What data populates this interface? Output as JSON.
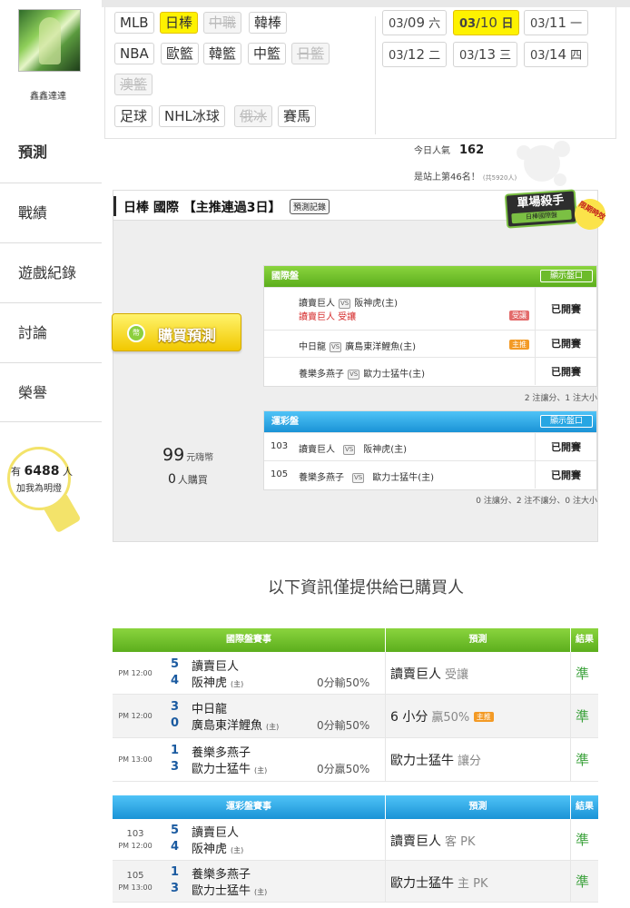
{
  "profile": {
    "username": "鑫鑫達達"
  },
  "nav": [
    {
      "label": "預測"
    },
    {
      "label": "戰績"
    },
    {
      "label": "遊戲紀錄"
    },
    {
      "label": "討論"
    },
    {
      "label": "榮譽"
    }
  ],
  "fans": {
    "prefix": "有",
    "count": "6488",
    "suffix": "人",
    "cta": "加我為明燈"
  },
  "leagues": {
    "row1": [
      "MLB",
      "日棒",
      "中職",
      "韓棒"
    ],
    "row2": [
      "NBA",
      "歐籃",
      "韓籃",
      "中籃",
      "日籃"
    ],
    "row3": [
      "澳籃"
    ],
    "row4": [
      "足球",
      "NHL冰球",
      "俄冰",
      "賽馬"
    ]
  },
  "dates": [
    {
      "md": "03/",
      "d": "09",
      "w": "六"
    },
    {
      "md": "03/",
      "d": "10",
      "w": "日"
    },
    {
      "md": "03/",
      "d": "11",
      "w": "一"
    },
    {
      "md": "03/",
      "d": "12",
      "w": "二"
    },
    {
      "md": "03/",
      "d": "13",
      "w": "三"
    },
    {
      "md": "03/",
      "d": "14",
      "w": "四"
    }
  ],
  "stats": {
    "pop_label": "今日人氣",
    "pop_value": "162",
    "rank_text": "是站上第46名！",
    "rank_note": "(共5920人)"
  },
  "header": {
    "title": "日棒 國際 【主推連過3日】",
    "record_btn": "預測記錄"
  },
  "badges": {
    "killer": "單場殺手",
    "killer_sub": "日棒國際盤",
    "limited": "限期時效"
  },
  "pricing": {
    "price": "99",
    "unit": "元嗨幣",
    "buyers": "0",
    "buyers_label": "人購買",
    "buy_label": "購買預測",
    "buy_icon": "coin-icon"
  },
  "intl": {
    "title": "國際盤",
    "show_btn": "顯示盤口",
    "rows": [
      {
        "away": "讀賣巨人",
        "home": "阪神虎(主)",
        "pick": "讀賣巨人 受讓",
        "tag": "受讓",
        "result": "已開賽"
      },
      {
        "away": "中日龍",
        "home": "廣島東洋鯉魚(主)",
        "pick": "",
        "tag": "主推",
        "result": "已開賽"
      },
      {
        "away": "養樂多燕子",
        "home": "歐力士猛牛(主)",
        "pick": "",
        "tag": "",
        "result": "已開賽"
      }
    ],
    "note": "2 注讓分、1 注大小"
  },
  "lottery": {
    "title": "運彩盤",
    "show_btn": "顯示盤口",
    "rows": [
      {
        "num": "103",
        "away": "讀賣巨人",
        "home": "阪神虎(主)",
        "result": "已開賽"
      },
      {
        "num": "105",
        "away": "養樂多燕子",
        "home": "歐力士猛牛(主)",
        "result": "已開賽"
      }
    ],
    "note": "0 注讓分、2 注不讓分、0 注大小"
  },
  "info_msg": "以下資訊僅提供給已購買人",
  "intl_table": {
    "headers": [
      "國際盤賽事",
      "預測",
      "結果"
    ],
    "rows": [
      {
        "time": "PM 12:00",
        "s1": "5",
        "t1": "讀賣巨人",
        "s2": "4",
        "t2": "阪神虎",
        "home": "(主)",
        "out": "0分輸50%",
        "pred": "讀賣巨人",
        "pred2": "受讓",
        "tag": "",
        "res": "準"
      },
      {
        "time": "PM 12:00",
        "s1": "3",
        "t1": "中日龍",
        "s2": "0",
        "t2": "廣島東洋鯉魚",
        "home": "(主)",
        "out": "0分輸50%",
        "pred": "6 小分",
        "pred2": "贏50%",
        "tag": "主推",
        "res": "準"
      },
      {
        "time": "PM 13:00",
        "s1": "1",
        "t1": "養樂多燕子",
        "s2": "3",
        "t2": "歐力士猛牛",
        "home": "(主)",
        "out": "0分贏50%",
        "pred": "歐力士猛牛",
        "pred2": "讓分",
        "tag": "",
        "res": "準"
      }
    ]
  },
  "lottery_table": {
    "headers": [
      "運彩盤賽事",
      "預測",
      "結果"
    ],
    "rows": [
      {
        "num": "103",
        "time": "PM 12:00",
        "s1": "5",
        "t1": "讀賣巨人",
        "s2": "4",
        "t2": "阪神虎",
        "home": "(主)",
        "pred": "讀賣巨人",
        "pred2": "客 PK",
        "res": "準"
      },
      {
        "num": "105",
        "time": "PM 13:00",
        "s1": "1",
        "t1": "養樂多燕子",
        "s2": "3",
        "t2": "歐力士猛牛",
        "home": "(主)",
        "pred": "歐力士猛牛",
        "pred2": "主 PK",
        "res": "準"
      }
    ]
  },
  "colors": {
    "accent_yellow": "#fef200",
    "green": "#5cae1d",
    "blue": "#1a93d6",
    "hit_green": "#3aa13a"
  }
}
